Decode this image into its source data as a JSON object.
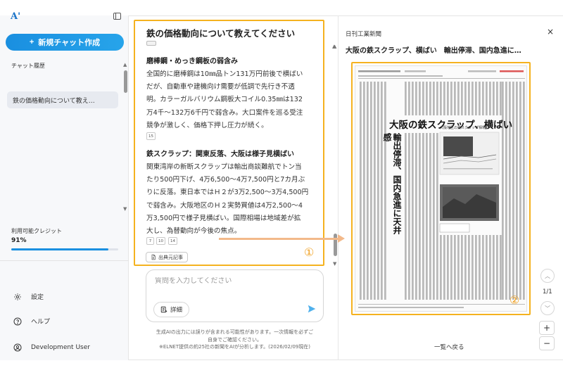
{
  "sidebar": {
    "logo": "A'",
    "new_chat_label": "新規チャット作成",
    "history_label": "チャット履歴",
    "history_items": [
      "鉄の価格動向について教え…"
    ],
    "credit_label": "利用可能クレジット",
    "credit_value": "91%",
    "credit_fraction": 0.91,
    "settings_label": "設定",
    "help_label": "ヘルプ",
    "user_label": "Development User"
  },
  "chat": {
    "title": "鉄の価格動向について教えてください",
    "sections": [
      {
        "heading": "磨棒鋼・めっき鋼板の弱含み",
        "lines": [
          "全国的に磨棒鋼は10㎜品トン131万円前後で横ばい",
          "だが、自動車や建機向け需要が低調で先行き不透",
          "明。カラーガルバリウム鋼板大コイル0.35㎜は132",
          "万4千〜132万6千円で弱含み。大口案件を巡る受注",
          "競争が激しく、価格下押し圧力が続く。"
        ],
        "citations": [
          "15"
        ]
      },
      {
        "heading": "鉄スクラップ：関東反落、大阪は様子見横ばい",
        "lines": [
          "関東湾岸の新断スクラップは輸出商談難航でトン当",
          "たり500円下げ、4万6,500〜4万7,500円と7カ月ぶ",
          "りに反落。東日本ではＨ２が3万2,500〜3万4,500円",
          "で弱含み。大阪地区のＨ２実勢買値は4万2,500〜4",
          "万3,500円で様子見横ばい。国際相場は地域差が拡",
          "大し、為替動向が今後の焦点。"
        ],
        "citations": [
          "7",
          "10",
          "14"
        ]
      }
    ],
    "source_button_label": "出典元記事",
    "marker_1": "①",
    "input_placeholder": "質問を入力してください",
    "detail_label": "詳細",
    "disclaimer_lines": [
      "生成AIの出力には誤りが含まれる可能性があります。一次情報を必ずご",
      "自身でご確認ください。",
      "※ELNET提供の約25社の新聞をAIが分析します。(2026/02/09現在)"
    ]
  },
  "source_panel": {
    "publisher": "日刊工業新聞",
    "article_title": "大阪の鉄スクラップ、横ばい　輸出停滞、国内急進に…",
    "paper": {
      "headline": "大阪の鉄スクラップ、横ばい",
      "vertical_headline": "輸出停滞、国内急進に天井感",
      "chart_caption": "大阪地区の鉄スクラップ相場"
    },
    "marker_2": "②",
    "page_count": "1/1",
    "zoom_in": "+",
    "zoom_out": "−",
    "back_label": "一覧へ戻る",
    "close_symbol": "×"
  },
  "icons": {
    "plus": "plus-icon",
    "settings": "gear-icon",
    "help": "help-circle-icon",
    "user": "user-circle-icon",
    "document": "document-icon",
    "send": "send-icon",
    "detail": "detail-list-icon",
    "close": "close-icon",
    "collapse": "sidebar-collapse-icon"
  },
  "colors": {
    "accent": "#1a8fe0",
    "highlight": "#f5b21f",
    "arrow": "#f3b98a",
    "marker": "#f0a020"
  }
}
